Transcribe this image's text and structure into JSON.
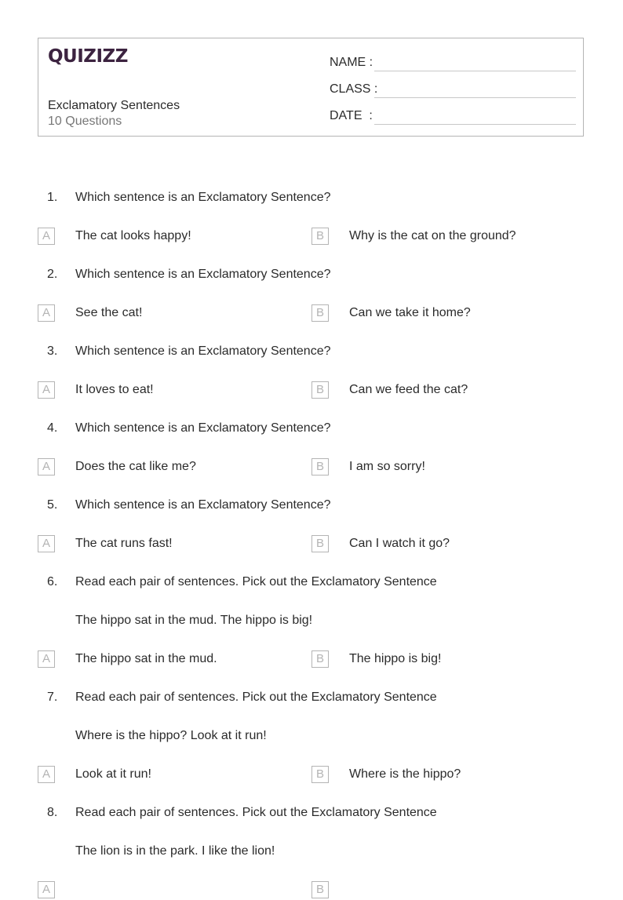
{
  "header": {
    "logo": "QUIZIZZ",
    "title": "Exclamatory Sentences",
    "question_count": "10 Questions",
    "fields": {
      "name": "NAME :",
      "class": "CLASS :",
      "date": "DATE  :"
    }
  },
  "colors": {
    "brand": "#3c2340",
    "border": "#b4b4b4",
    "text": "#2b2b2b",
    "muted": "#777777"
  },
  "questions": [
    {
      "number": "1.",
      "prompt": "Which sentence is an Exclamatory Sentence?",
      "options": [
        {
          "letter": "A",
          "text": "The cat looks happy!"
        },
        {
          "letter": "B",
          "text": "Why is the cat on the ground?"
        }
      ]
    },
    {
      "number": "2.",
      "prompt": "Which sentence is an Exclamatory Sentence?",
      "options": [
        {
          "letter": "A",
          "text": "See the cat!"
        },
        {
          "letter": "B",
          "text": "Can we take it home?"
        }
      ]
    },
    {
      "number": "3.",
      "prompt": "Which sentence is an Exclamatory Sentence?",
      "options": [
        {
          "letter": "A",
          "text": "It loves to eat!"
        },
        {
          "letter": "B",
          "text": "Can we feed the cat?"
        }
      ]
    },
    {
      "number": "4.",
      "prompt": "Which sentence is an Exclamatory Sentence?",
      "options": [
        {
          "letter": "A",
          "text": "Does the cat like me?"
        },
        {
          "letter": "B",
          "text": "I am so sorry!"
        }
      ]
    },
    {
      "number": "5.",
      "prompt": "Which sentence is an Exclamatory Sentence?",
      "options": [
        {
          "letter": "A",
          "text": "The cat runs fast!"
        },
        {
          "letter": "B",
          "text": "Can I watch it go?"
        }
      ]
    },
    {
      "number": "6.",
      "prompt": "Read each pair of sentences. Pick out the Exclamatory Sentence",
      "passage": "The hippo sat in the mud. The hippo is big!",
      "options": [
        {
          "letter": "A",
          "text": "The hippo sat in the mud."
        },
        {
          "letter": "B",
          "text": "The hippo is big!"
        }
      ]
    },
    {
      "number": "7.",
      "prompt": "Read each pair of sentences. Pick out the Exclamatory Sentence",
      "passage": "Where is the hippo? Look at it run!",
      "options": [
        {
          "letter": "A",
          "text": "Look at it run!"
        },
        {
          "letter": "B",
          "text": "Where is the hippo?"
        }
      ]
    },
    {
      "number": "8.",
      "prompt": "Read each pair of sentences. Pick out the Exclamatory Sentence",
      "passage": "The lion is in the park. I like the lion!",
      "options": [
        {
          "letter": "A",
          "text": ""
        },
        {
          "letter": "B",
          "text": ""
        }
      ]
    }
  ]
}
